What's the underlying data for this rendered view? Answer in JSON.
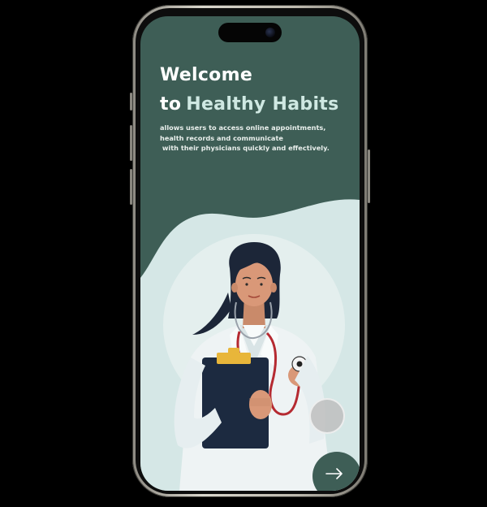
{
  "onboarding": {
    "title_line1": "Welcome",
    "title_line2_prefix": "to",
    "title_line2_accent": "Healthy Habits",
    "description": "allows users to access online appointments,\nhealth records and communicate\n with their physicians quickly and effectively."
  },
  "icons": {
    "next": "arrow-right-icon",
    "illustration": "doctor-with-stethoscope-illustration"
  },
  "colors": {
    "primary": "#3e5e56",
    "background_light": "#d4e6e5",
    "accent_text": "#cfe8e2"
  }
}
